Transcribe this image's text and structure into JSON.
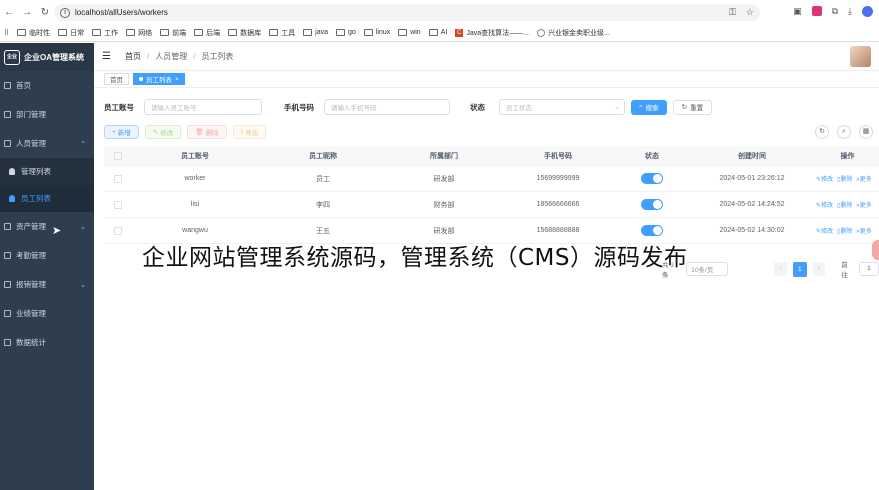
{
  "browser": {
    "url": "localhost/allUsers/workers",
    "bookmarks": [
      "临时性",
      "日常",
      "工作",
      "网络",
      "前端",
      "后端",
      "数据库",
      "工具",
      "java",
      "go",
      "linux",
      "win",
      "AI",
      "Java查找算法——...",
      "兴业银金卖职业级..."
    ]
  },
  "app": {
    "title": "企业OA管理系统",
    "logo_text": "企业"
  },
  "sidebar": {
    "items": [
      {
        "label": "首页"
      },
      {
        "label": "部门管理"
      },
      {
        "label": "人员管理"
      },
      {
        "label": "管理列表"
      },
      {
        "label": "员工列表"
      },
      {
        "label": "资产管理"
      },
      {
        "label": "考勤管理"
      },
      {
        "label": "报销管理"
      },
      {
        "label": "业绩管理"
      },
      {
        "label": "数据统计"
      }
    ]
  },
  "header": {
    "breadcrumb": [
      "首页",
      "人员管理",
      "员工列表"
    ]
  },
  "tags": [
    "首页",
    "员工列表"
  ],
  "search": {
    "account_label": "员工账号",
    "account_placeholder": "请输入员工账号",
    "phone_label": "手机号码",
    "phone_placeholder": "请输入手机号码",
    "status_label": "状态",
    "status_placeholder": "员工状态",
    "search_btn": "搜索",
    "reset_btn": "重置"
  },
  "actions": {
    "add": "新增",
    "edit": "修改",
    "delete": "删除",
    "export": "导出"
  },
  "table": {
    "headers": [
      "员工账号",
      "员工昵称",
      "所属部门",
      "手机号码",
      "状态",
      "创建时间",
      "操作"
    ],
    "rows": [
      {
        "account": "worker",
        "nickname": "员工",
        "dept": "研发部",
        "phone": "15699999999",
        "enabled": true,
        "created": "2024-05-01 23:26:12"
      },
      {
        "account": "lisi",
        "nickname": "李四",
        "dept": "财务部",
        "phone": "18566666666",
        "enabled": true,
        "created": "2024-05-02 14:24:52"
      },
      {
        "account": "wangwu",
        "nickname": "王五",
        "dept": "研发部",
        "phone": "15688888888",
        "enabled": true,
        "created": "2024-05-02 14:30:02"
      }
    ],
    "row_ops": [
      "修改",
      "删除",
      "更多"
    ]
  },
  "pager": {
    "total": "共 3 条",
    "size": "10条/页",
    "current": "1",
    "goto_label": "前往",
    "goto_value": "1"
  },
  "caption": "企业网站管理系统源码，管理系统（CMS）源码发布"
}
